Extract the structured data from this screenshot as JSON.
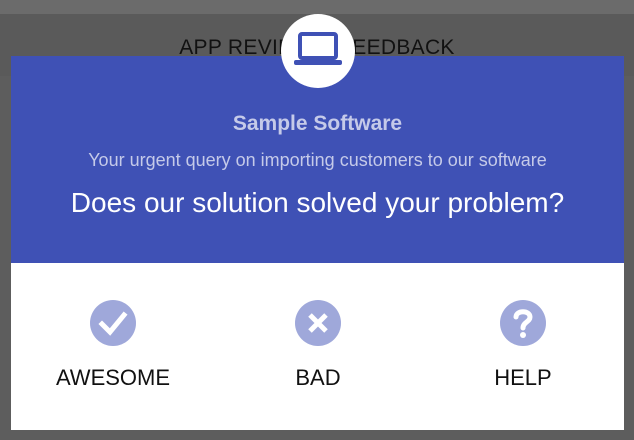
{
  "background": {
    "header_title": "APP REVIEW & FEEDBACK"
  },
  "dialog": {
    "app_icon": "laptop-icon",
    "app_name": "Sample Software",
    "subtitle": "Your urgent query on importing customers to our software",
    "question": "Does our solution solved your problem?",
    "colors": {
      "header_bg": "#3f51b5",
      "icon_circle": "#9fa8da",
      "muted_text": "#c5cae9"
    },
    "options": [
      {
        "icon": "check-icon",
        "label": "AWESOME"
      },
      {
        "icon": "x-icon",
        "label": "BAD"
      },
      {
        "icon": "question-icon",
        "label": "HELP"
      }
    ]
  }
}
